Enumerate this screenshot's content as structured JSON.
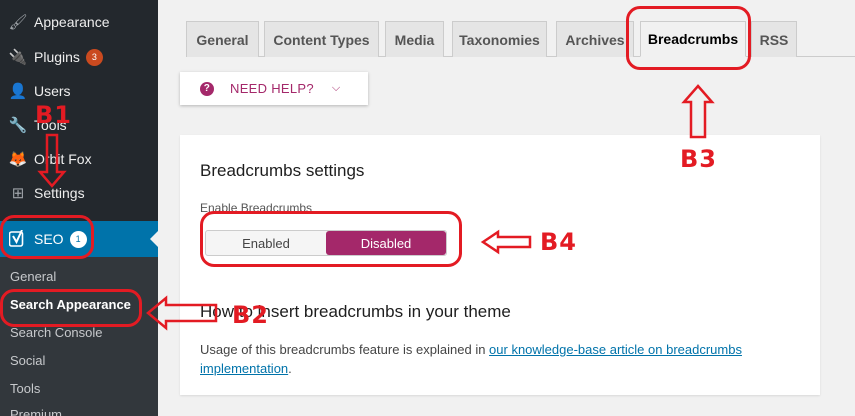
{
  "sidebar": {
    "items": [
      {
        "label": "Appearance",
        "icon": "appearance-icon"
      },
      {
        "label": "Plugins",
        "icon": "plugins-icon",
        "badge": "3"
      },
      {
        "label": "Users",
        "icon": "users-icon"
      },
      {
        "label": "Tools",
        "icon": "tools-icon"
      },
      {
        "label": "Orbit Fox",
        "icon": "orbit-fox-icon"
      },
      {
        "label": "Settings",
        "icon": "settings-icon"
      }
    ],
    "seo": {
      "label": "SEO",
      "badge": "1",
      "icon": "yoast-icon"
    },
    "submenu": [
      "General",
      "Search Appearance",
      "Search Console",
      "Social",
      "Tools",
      "Premium"
    ]
  },
  "tabs": [
    "General",
    "Content Types",
    "Media",
    "Taxonomies",
    "Archives",
    "Breadcrumbs",
    "RSS"
  ],
  "active_tab": "Breadcrumbs",
  "help": {
    "label": "NEED HELP?"
  },
  "card": {
    "title": "Breadcrumbs settings",
    "field_label": "Enable Breadcrumbs",
    "toggle": {
      "enabled": "Enabled",
      "disabled": "Disabled",
      "selected": "Disabled"
    },
    "h2": "How to insert breadcrumbs in your theme",
    "text_before": "Usage of this breadcrumbs feature is explained in ",
    "link": "our knowledge-base article on breadcrumbs implementation",
    "text_after": "."
  },
  "annotations": {
    "b1": "B1",
    "b2": "B2",
    "b3": "B3",
    "b4": "B4"
  },
  "colors": {
    "sidebar": "#23282d",
    "submenu": "#32373c",
    "seo_active": "#0073aa",
    "accent": "#a4286a",
    "annotation": "#e31b23"
  }
}
